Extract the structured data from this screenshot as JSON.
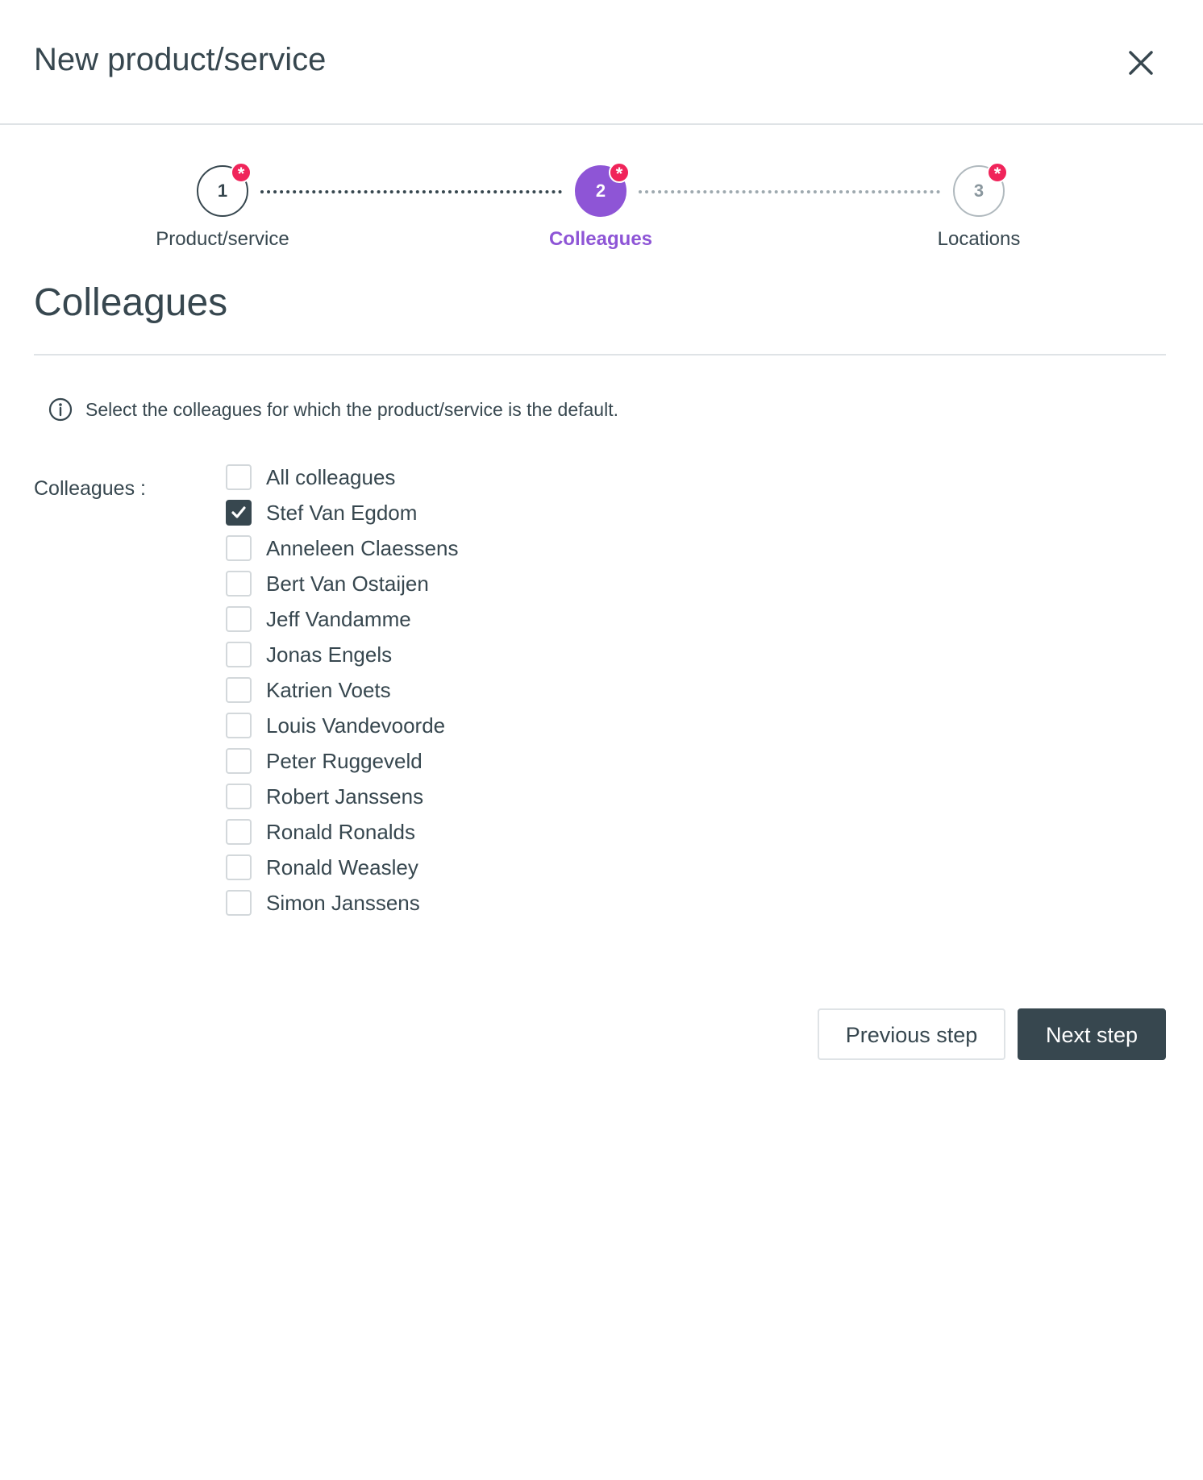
{
  "dialog": {
    "title": "New product/service",
    "close_icon": "close-icon"
  },
  "stepper": {
    "steps": [
      {
        "number": "1",
        "label": "Product/service",
        "state": "completed",
        "required_marker": "*"
      },
      {
        "number": "2",
        "label": "Colleagues",
        "state": "active",
        "required_marker": "*"
      },
      {
        "number": "3",
        "label": "Locations",
        "state": "upcoming",
        "required_marker": "*"
      }
    ],
    "active_color": "#8e55d6",
    "required_color": "#f0245a"
  },
  "section": {
    "title": "Colleagues",
    "info_icon": "info-icon",
    "info_text": "Select the colleagues for which the product/service is the default."
  },
  "colleagues_field": {
    "label": "Colleagues :",
    "options": [
      {
        "label": "All colleagues",
        "checked": false
      },
      {
        "label": "Stef Van Egdom",
        "checked": true
      },
      {
        "label": "Anneleen Claessens",
        "checked": false
      },
      {
        "label": "Bert Van Ostaijen",
        "checked": false
      },
      {
        "label": "Jeff Vandamme",
        "checked": false
      },
      {
        "label": "Jonas Engels",
        "checked": false
      },
      {
        "label": "Katrien Voets",
        "checked": false
      },
      {
        "label": "Louis Vandevoorde",
        "checked": false
      },
      {
        "label": "Peter Ruggeveld",
        "checked": false
      },
      {
        "label": "Robert Janssens",
        "checked": false
      },
      {
        "label": "Ronald Ronalds",
        "checked": false
      },
      {
        "label": "Ronald Weasley",
        "checked": false
      },
      {
        "label": "Simon Janssens",
        "checked": false
      }
    ]
  },
  "footer": {
    "previous_label": "Previous step",
    "next_label": "Next step"
  }
}
